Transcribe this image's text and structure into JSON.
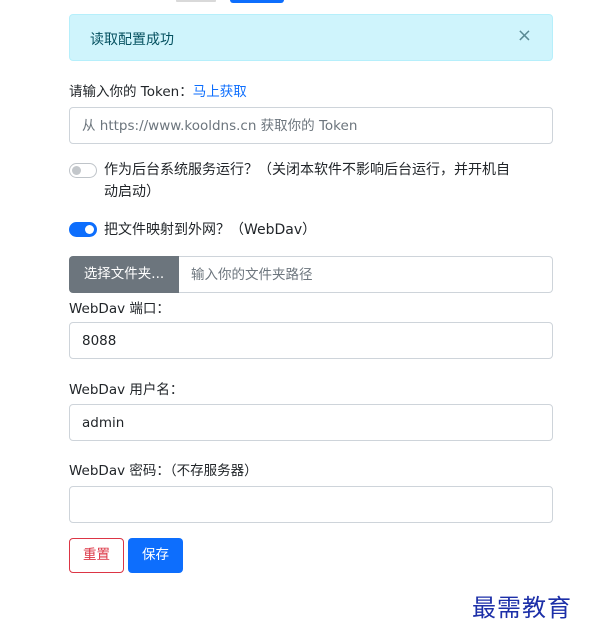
{
  "alert": {
    "message": "读取配置成功",
    "close_glyph": "×"
  },
  "token": {
    "label": "请输入你的 Token：",
    "link_text": "马上获取",
    "placeholder": "从 https://www.kooldns.cn 获取你的 Token"
  },
  "service_switch": {
    "checked": false,
    "label_line1": "作为后台系统服务运行？（关闭本软件不影响后台运行，并开机自",
    "label_line2": "动启动）"
  },
  "webdav_switch": {
    "checked": true,
    "label": "把文件映射到外网？（WebDav）"
  },
  "folder": {
    "button_label": "选择文件夹...",
    "placeholder": "输入你的文件夹路径"
  },
  "port": {
    "label": "WebDav 端口：",
    "value": "8088"
  },
  "username": {
    "label": "WebDav 用户名：",
    "value": "admin"
  },
  "password": {
    "label": "WebDav 密码：（不存服务器）",
    "value": ""
  },
  "actions": {
    "reset_label": "重置",
    "save_label": "保存"
  },
  "watermark": {
    "text": "最需教育"
  },
  "colors": {
    "primary": "#0d6efd",
    "danger": "#dc3545",
    "secondary": "#6c757d",
    "alert_bg": "#cff4fc",
    "alert_text": "#055160"
  }
}
